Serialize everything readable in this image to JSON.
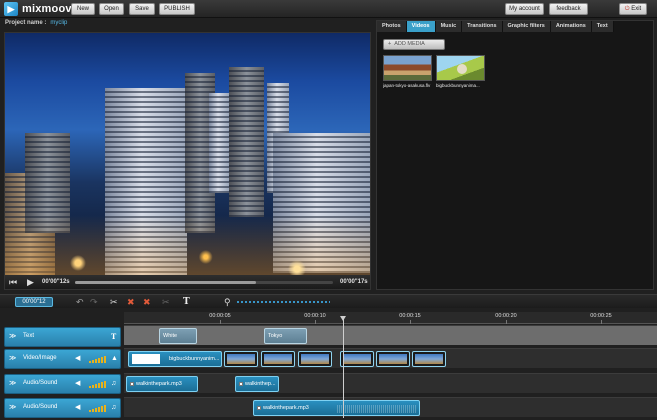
{
  "app": {
    "logo_text": "mixmoov"
  },
  "topbar": {
    "new_label": "New",
    "open_label": "Open",
    "save_label": "Save",
    "publish_label": "PUBLISH",
    "account_label": "My account",
    "feedback_label": "feedback",
    "exit_label": "Exit"
  },
  "project": {
    "name_label": "Project name :",
    "name_value": "myclip"
  },
  "player": {
    "current_time": "00'00\"12s",
    "total_time": "00'00\"17s",
    "progress": 0.7
  },
  "media_panel": {
    "tabs": [
      "Photos",
      "Videos",
      "Music",
      "Transitions",
      "Graphic filters",
      "Animations",
      "Text"
    ],
    "active_tab": "Videos",
    "add_media_label": "ADD MEDIA",
    "items": [
      {
        "caption": "japan-tokyo-asakusa.flv"
      },
      {
        "caption": "bigbuckbunnyanima..."
      }
    ]
  },
  "timeline": {
    "timecode": "00'00\"12",
    "ruler_labels": [
      "00:00:05",
      "00:00:10",
      "00:00:15",
      "00:00:20",
      "00:00:25"
    ],
    "tracks": [
      {
        "label": "Text",
        "clips": [
          "White",
          "Tokyo"
        ]
      },
      {
        "label": "Video/Image",
        "clips": [
          "bigbuckbunnyanim..."
        ]
      },
      {
        "label": "Audio/Sound",
        "clips": [
          "walkinthepark.mp3",
          "walkinthep..."
        ]
      },
      {
        "label": "Audio/Sound",
        "clips": [
          "walkinthepark.mp3"
        ]
      }
    ]
  },
  "colors": {
    "accent": "#3aa0c9",
    "track_head": "#2a80ab"
  }
}
